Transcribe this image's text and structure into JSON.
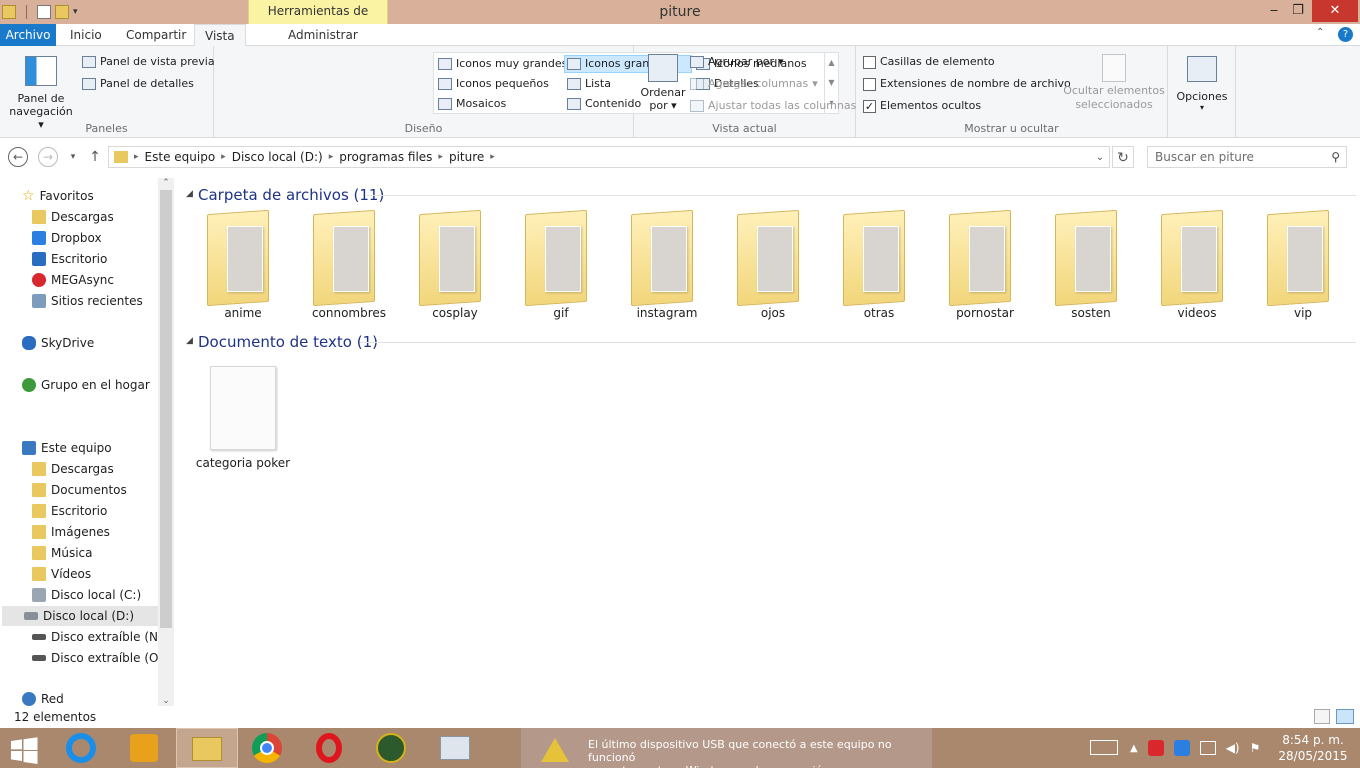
{
  "window": {
    "title": "piture",
    "context_tab": "Herramientas de imagen",
    "controls": {
      "minimize": "‒",
      "maximize": "❐",
      "close": "✕"
    }
  },
  "tabs": [
    {
      "label": "Archivo"
    },
    {
      "label": "Inicio"
    },
    {
      "label": "Compartir"
    },
    {
      "label": "Vista"
    },
    {
      "label": "Administrar"
    }
  ],
  "ribbon": {
    "paneles": {
      "nav_pane_label_1": "Panel de",
      "nav_pane_label_2": "navegación",
      "preview": "Panel de vista previa",
      "details": "Panel de detalles",
      "group": "Paneles"
    },
    "diseno": {
      "items": [
        "Iconos muy grandes",
        "Iconos grandes",
        "Iconos medianos",
        "Iconos pequeños",
        "Lista",
        "Detalles",
        "Mosaicos",
        "Contenido"
      ],
      "group": "Diseño"
    },
    "vista_actual": {
      "sort_1": "Ordenar",
      "sort_2": "por",
      "group_by": "Agrupar por",
      "add_columns": "Agregar columnas",
      "fit_columns": "Ajustar todas las columnas",
      "group": "Vista actual"
    },
    "mostrar": {
      "checkboxes": "Casillas de elemento",
      "extensions": "Extensiones de nombre de archivo",
      "hidden": "Elementos ocultos",
      "hide_1": "Ocultar elementos",
      "hide_2": "seleccionados",
      "group": "Mostrar u ocultar"
    },
    "options": "Opciones"
  },
  "address": {
    "crumbs": [
      "Este equipo",
      "Disco local (D:)",
      "programas files",
      "piture"
    ],
    "search_placeholder": "Buscar en piture"
  },
  "nav_pane": {
    "favorites": "Favoritos",
    "fav_items": [
      "Descargas",
      "Dropbox",
      "Escritorio",
      "MEGAsync",
      "Sitios recientes"
    ],
    "skydrive": "SkyDrive",
    "homegroup": "Grupo en el hogar",
    "this_pc": "Este equipo",
    "pc_items": [
      "Descargas",
      "Documentos",
      "Escritorio",
      "Imágenes",
      "Música",
      "Vídeos",
      "Disco local (C:)",
      "Disco local (D:)",
      "Disco extraíble (N:)",
      "Disco extraíble (O:)"
    ],
    "network": "Red"
  },
  "content": {
    "folders_header": "Carpeta de archivos (11)",
    "folders": [
      "anime",
      "connombres",
      "cosplay",
      "gif",
      "instagram",
      "ojos",
      "otras",
      "pornostar",
      "sosten",
      "videos",
      "vip"
    ],
    "docs_header": "Documento de texto (1)",
    "docs": [
      "categoria poker"
    ]
  },
  "status": {
    "count": "12 elementos"
  },
  "taskbar": {
    "notification_1": "El último dispositivo USB que conectó a este equipo no funcionó",
    "notification_2": "correctamente, y Windows no lo reconoció.",
    "time": "8:54 p. m.",
    "date": "28/05/2015"
  }
}
